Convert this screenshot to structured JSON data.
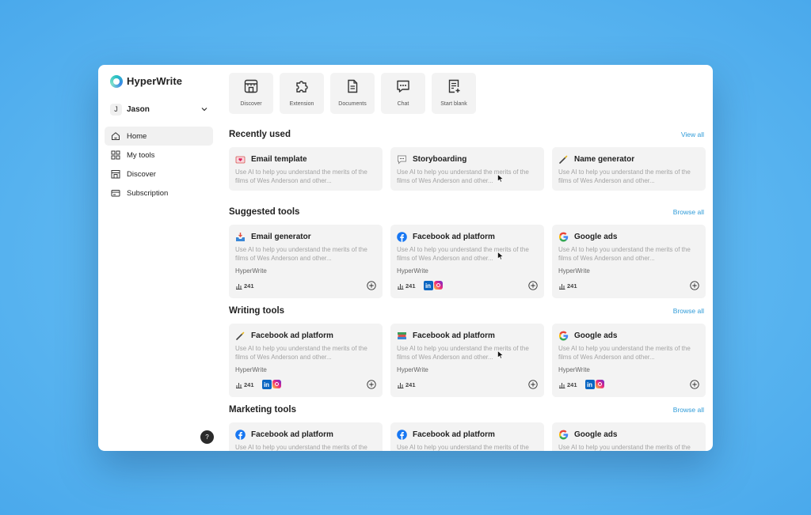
{
  "brand": {
    "name": "HyperWrite"
  },
  "user": {
    "initial": "J",
    "name": "Jason"
  },
  "nav": [
    {
      "label": "Home",
      "icon": "home-icon",
      "active": true
    },
    {
      "label": "My tools",
      "icon": "grid-icon"
    },
    {
      "label": "Discover",
      "icon": "store-icon"
    },
    {
      "label": "Subscription",
      "icon": "card-icon"
    }
  ],
  "help": {
    "label": "?"
  },
  "quick_actions": [
    {
      "label": "Discover",
      "icon": "store-icon"
    },
    {
      "label": "Extension",
      "icon": "puzzle-icon"
    },
    {
      "label": "Documents",
      "icon": "document-icon"
    },
    {
      "label": "Chat",
      "icon": "chat-icon"
    },
    {
      "label": "Start blank",
      "icon": "new-file-icon"
    }
  ],
  "description": "Use AI to help you understand the merits of the films of Wes Anderson and other...",
  "sections": [
    {
      "title": "Recently used",
      "link": "View all",
      "cards": [
        {
          "title": "Email template",
          "icon": "envelope-heart-icon"
        },
        {
          "title": "Storyboarding",
          "icon": "speech-bubble-icon"
        },
        {
          "title": "Name generator",
          "icon": "magic-wand-icon"
        }
      ]
    },
    {
      "title": "Suggested tools",
      "link": "Browse all",
      "cards": [
        {
          "title": "Email generator",
          "icon": "inbox-tray-icon",
          "author": "HyperWrite",
          "count": "241"
        },
        {
          "title": "Facebook ad platform",
          "icon": "facebook-icon",
          "author": "HyperWrite",
          "count": "241",
          "socials": true
        },
        {
          "title": "Google ads",
          "icon": "google-icon",
          "author": "HyperWrite",
          "count": "241"
        }
      ]
    },
    {
      "title": "Writing tools",
      "link": "Browse all",
      "cards": [
        {
          "title": "Facebook ad platform",
          "icon": "magic-wand-icon",
          "author": "HyperWrite",
          "count": "241",
          "socials": true
        },
        {
          "title": "Facebook ad platform",
          "icon": "books-icon",
          "author": "HyperWrite",
          "count": "241"
        },
        {
          "title": "Google ads",
          "icon": "google-icon",
          "author": "HyperWrite",
          "count": "241",
          "socials": true
        }
      ]
    },
    {
      "title": "Marketing tools",
      "link": "Browse all",
      "cards": [
        {
          "title": "Facebook ad platform",
          "icon": "facebook-icon"
        },
        {
          "title": "Facebook ad platform",
          "icon": "facebook-icon"
        },
        {
          "title": "Google ads",
          "icon": "google-icon"
        }
      ]
    }
  ],
  "colors": {
    "accent": "#2f9bd8",
    "card_bg": "#f3f3f3",
    "page_bg": "#5ab5f0"
  }
}
